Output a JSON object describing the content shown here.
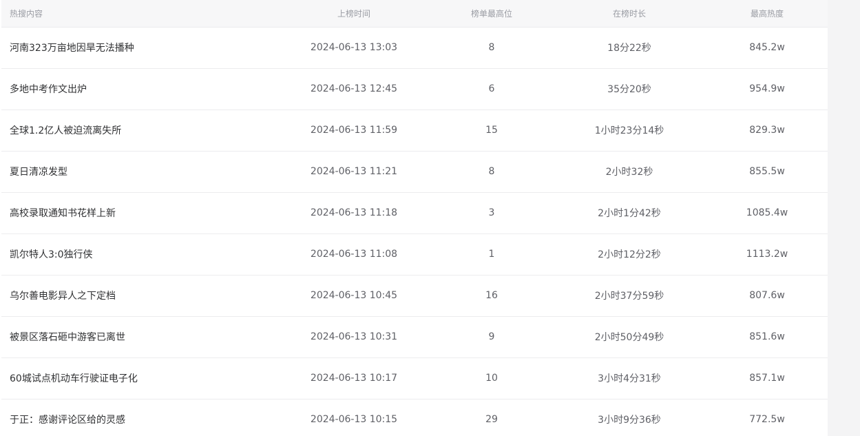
{
  "headers": {
    "topic": "热搜内容",
    "time": "上榜时间",
    "rank": "榜单最高位",
    "duration": "在榜时长",
    "heat": "最高热度"
  },
  "rows": [
    {
      "topic": "河南323万亩地因旱无法播种",
      "time": "2024-06-13 13:03",
      "rank": "8",
      "duration": "18分22秒",
      "heat": "845.2w"
    },
    {
      "topic": "多地中考作文出炉",
      "time": "2024-06-13 12:45",
      "rank": "6",
      "duration": "35分20秒",
      "heat": "954.9w"
    },
    {
      "topic": "全球1.2亿人被迫流离失所",
      "time": "2024-06-13 11:59",
      "rank": "15",
      "duration": "1小时23分14秒",
      "heat": "829.3w"
    },
    {
      "topic": "夏日清凉发型",
      "time": "2024-06-13 11:21",
      "rank": "8",
      "duration": "2小时32秒",
      "heat": "855.5w"
    },
    {
      "topic": "高校录取通知书花样上新",
      "time": "2024-06-13 11:18",
      "rank": "3",
      "duration": "2小时1分42秒",
      "heat": "1085.4w"
    },
    {
      "topic": "凯尔特人3:0独行侠",
      "time": "2024-06-13 11:08",
      "rank": "1",
      "duration": "2小时12分2秒",
      "heat": "1113.2w"
    },
    {
      "topic": "乌尔善电影异人之下定档",
      "time": "2024-06-13 10:45",
      "rank": "16",
      "duration": "2小时37分59秒",
      "heat": "807.6w"
    },
    {
      "topic": "被景区落石砸中游客已离世",
      "time": "2024-06-13 10:31",
      "rank": "9",
      "duration": "2小时50分49秒",
      "heat": "851.6w"
    },
    {
      "topic": "60城试点机动车行驶证电子化",
      "time": "2024-06-13 10:17",
      "rank": "10",
      "duration": "3小时4分31秒",
      "heat": "857.1w"
    },
    {
      "topic": "于正：感谢评论区给的灵感",
      "time": "2024-06-13 10:15",
      "rank": "29",
      "duration": "3小时9分36秒",
      "heat": "772.5w"
    }
  ]
}
